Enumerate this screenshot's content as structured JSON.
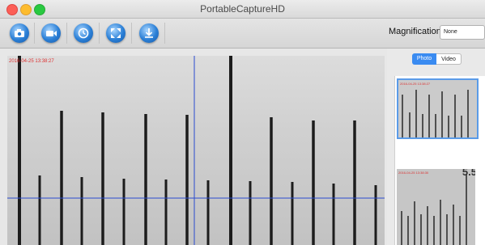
{
  "window": {
    "title": "PortableCaptureHD"
  },
  "toolbar": {
    "buttons": [
      {
        "icon": "capture-photo-icon"
      },
      {
        "icon": "record-video-icon"
      },
      {
        "icon": "timer-icon"
      },
      {
        "icon": "fullscreen-icon"
      },
      {
        "icon": "download-icon"
      }
    ],
    "magnification_label": "Magnification:",
    "magnification_value": "None"
  },
  "preview": {
    "timestamp": "2016-04-25 13:38:27"
  },
  "gallery": {
    "tabs": [
      {
        "label": "Photo",
        "selected": true
      },
      {
        "label": "Video",
        "selected": false
      }
    ],
    "thumbnails": [
      {
        "timestamp": "2016-04-25 13:38:27",
        "selected": true
      },
      {
        "timestamp": "2016-04-25 13:38:30",
        "number": "5.5",
        "selected": false
      }
    ]
  },
  "colors": {
    "accent": "#3a8bf1",
    "crosshair": "#2a4bd0",
    "timestamp": "#dd3333"
  }
}
